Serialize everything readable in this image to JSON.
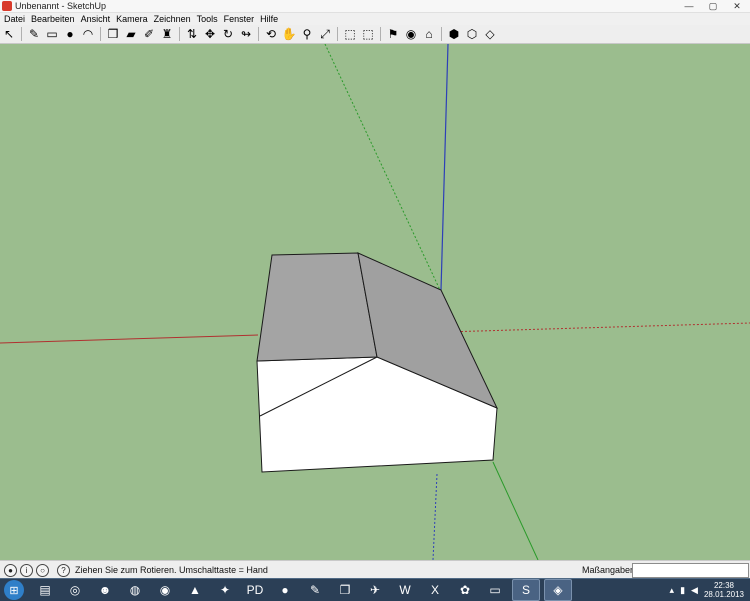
{
  "window": {
    "title": "Unbenannt - SketchUp",
    "buttons": {
      "minimize": "—",
      "maximize": "▢",
      "close": "✕"
    }
  },
  "menu": [
    "Datei",
    "Bearbeiten",
    "Ansicht",
    "Kamera",
    "Zeichnen",
    "Tools",
    "Fenster",
    "Hilfe"
  ],
  "toolbar": {
    "tools": [
      {
        "name": "select",
        "icon": "cursor-arrow-icon",
        "glyph": "↖"
      },
      {
        "name": "sep"
      },
      {
        "name": "pencil",
        "icon": "pencil-icon",
        "glyph": "✎"
      },
      {
        "name": "rectangle",
        "icon": "rectangle-icon",
        "glyph": "▭"
      },
      {
        "name": "circle",
        "icon": "circle-icon",
        "glyph": "●"
      },
      {
        "name": "arc",
        "icon": "arc-icon",
        "glyph": "◠"
      },
      {
        "name": "sep"
      },
      {
        "name": "make-component",
        "icon": "component-icon",
        "glyph": "❒"
      },
      {
        "name": "eraser",
        "icon": "eraser-icon",
        "glyph": "▰"
      },
      {
        "name": "tape-measure",
        "icon": "tape-measure-icon",
        "glyph": "✐"
      },
      {
        "name": "paint-bucket",
        "icon": "paint-bucket-icon",
        "glyph": "♜"
      },
      {
        "name": "sep"
      },
      {
        "name": "push-pull",
        "icon": "push-pull-icon",
        "glyph": "⇅"
      },
      {
        "name": "move",
        "icon": "move-icon",
        "glyph": "✥"
      },
      {
        "name": "rotate",
        "icon": "rotate-icon",
        "glyph": "↻"
      },
      {
        "name": "follow-me",
        "icon": "follow-me-icon",
        "glyph": "↬"
      },
      {
        "name": "sep"
      },
      {
        "name": "orbit",
        "icon": "orbit-icon",
        "glyph": "⟲"
      },
      {
        "name": "pan",
        "icon": "pan-hand-icon",
        "glyph": "✋"
      },
      {
        "name": "zoom",
        "icon": "zoom-icon",
        "glyph": "⚲"
      },
      {
        "name": "zoom-extents",
        "icon": "zoom-extents-icon",
        "glyph": "⤢"
      },
      {
        "name": "sep"
      },
      {
        "name": "previous-view",
        "icon": "previous-view-icon",
        "glyph": "⬚"
      },
      {
        "name": "next-view",
        "icon": "next-view-icon",
        "glyph": "⬚"
      },
      {
        "name": "sep"
      },
      {
        "name": "add-location",
        "icon": "add-location-icon",
        "glyph": "⚑"
      },
      {
        "name": "toggle-terrain",
        "icon": "terrain-icon",
        "glyph": "◉"
      },
      {
        "name": "photo-textures",
        "icon": "photo-textures-icon",
        "glyph": "⌂"
      },
      {
        "name": "sep"
      },
      {
        "name": "get-models",
        "icon": "get-models-icon",
        "glyph": "⬢"
      },
      {
        "name": "share-model",
        "icon": "share-model-icon",
        "glyph": "⬡"
      },
      {
        "name": "share-component",
        "icon": "share-component-icon",
        "glyph": "◇"
      }
    ]
  },
  "viewport": {
    "background": "#9bbd8e",
    "axis_colors": {
      "red": "#b03030",
      "green": "#2a9a2a",
      "blue": "#2d3fb8"
    },
    "model": {
      "roof_color": "#a4a4a4",
      "wall_color": "#ffffff",
      "edge_color": "#1a1a1a"
    }
  },
  "status": {
    "help_icon": "?",
    "text": "Ziehen Sie zum Rotieren.  Umschalttaste = Hand",
    "vcb_label": "Maßangaben",
    "vcb_value": ""
  },
  "taskbar": {
    "apps": [
      {
        "name": "explorer",
        "icon": "folder-icon",
        "glyph": "▤"
      },
      {
        "name": "media",
        "icon": "media-icon",
        "glyph": "◎"
      },
      {
        "name": "app3",
        "icon": "helmet-icon",
        "glyph": "☻"
      },
      {
        "name": "firefox",
        "icon": "firefox-icon",
        "glyph": "◍"
      },
      {
        "name": "cd-burner",
        "icon": "disc-icon",
        "glyph": "◉"
      },
      {
        "name": "vlc",
        "icon": "vlc-cone-icon",
        "glyph": "▲"
      },
      {
        "name": "app7",
        "icon": "puzzle-icon",
        "glyph": "✦"
      },
      {
        "name": "pd",
        "icon": "pd-icon",
        "glyph": "PD"
      },
      {
        "name": "app9",
        "icon": "red-dot-icon",
        "glyph": "●"
      },
      {
        "name": "app10",
        "icon": "pen-icon",
        "glyph": "✎"
      },
      {
        "name": "app11",
        "icon": "window-icon",
        "glyph": "❐"
      },
      {
        "name": "app12",
        "icon": "plane-icon",
        "glyph": "✈"
      },
      {
        "name": "word",
        "icon": "word-icon",
        "glyph": "W"
      },
      {
        "name": "excel",
        "icon": "excel-icon",
        "glyph": "X"
      },
      {
        "name": "app15",
        "icon": "fox-icon",
        "glyph": "✿"
      },
      {
        "name": "cmd",
        "icon": "terminal-icon",
        "glyph": "▭"
      },
      {
        "name": "sketchup",
        "icon": "sketchup-icon",
        "glyph": "S",
        "active": true
      },
      {
        "name": "app18",
        "icon": "green-app-icon",
        "glyph": "◈",
        "active": true
      }
    ],
    "time": "22:38",
    "date": "28.01.2013"
  }
}
